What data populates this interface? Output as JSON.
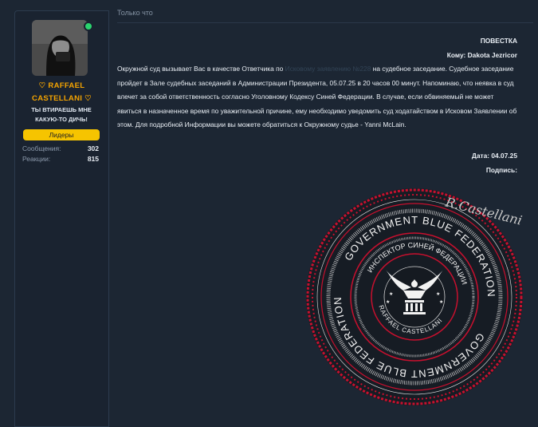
{
  "user": {
    "name": "♡ RAFFAEL CASTELLANI ♡",
    "title": "ТЫ ВТИРАЕШЬ МНЕ КАКУЮ-ТО ДИЧЬ!",
    "rank": "Лидеры",
    "stats": [
      {
        "label": "Сообщения:",
        "value": "302"
      },
      {
        "label": "Реакции:",
        "value": "815"
      }
    ]
  },
  "post": {
    "time": "Только что",
    "heading": "ПОВЕСТКА",
    "to": "Кому: Dakota Jezricor",
    "p1_start": "Окружной суд вызывает Вас в качестве Ответчика по ",
    "p1_link": "Исковому заявлению №228",
    "p1_end": " на судебное заседание. Судебное заседание пройдет в Зале судебных заседаний в Администрации Президента, 05.07.25 в 20 часов 00 минут. Напоминаю, что неявка в суд влечет за собой ответственность согласно Уголовному Кодексу Синей Федерации. В случае, если обвиняемый не может явиться в назначенное время по уважительной причине, ему необходимо уведомить суд ходатайством в Исковом Заявлении об этом. Для подробной Информации вы можете обратиться к Окружному судье - Yanni McLain.",
    "date": "Дата: 04.07.25",
    "signature": "Подпись:"
  },
  "seal": {
    "signature_text": "R.Castellani",
    "outer_text": "GOVERNMENT BLUE FEDERATION",
    "inner_text": "ИНСПЕКТОР СИНЕЙ ФЕДЕРАЦИИ",
    "name_text": "RAFFAEL CASTELLANI",
    "colors": {
      "red": "#c8102e",
      "white": "#f2f2f2",
      "dark": "#171d25"
    }
  }
}
